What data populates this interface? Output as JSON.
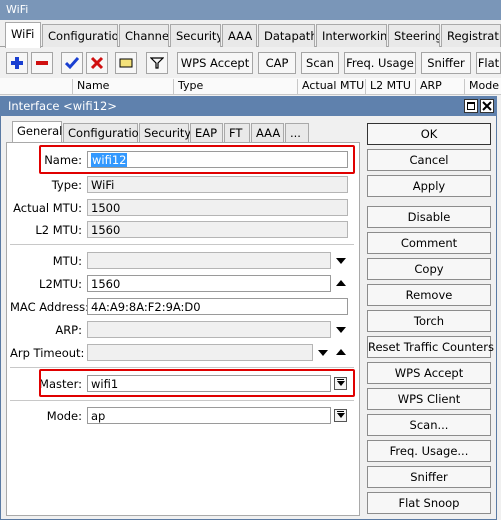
{
  "window": {
    "title": "WiFi"
  },
  "tabs": [
    {
      "label": "WiFi"
    },
    {
      "label": "Configuration"
    },
    {
      "label": "Channel"
    },
    {
      "label": "Security"
    },
    {
      "label": "AAA"
    },
    {
      "label": "Datapath"
    },
    {
      "label": "Interworking"
    },
    {
      "label": "Steering"
    },
    {
      "label": "Registration"
    }
  ],
  "toolbar": {
    "wps_accept": "WPS Accept",
    "cap": "CAP",
    "scan": "Scan",
    "freq_usage": "Freq. Usage",
    "sniffer": "Sniffer",
    "flat": "Flat"
  },
  "columns": [
    "Name",
    "Type",
    "Actual MTU",
    "L2 MTU",
    "ARP",
    "Mode"
  ],
  "dialog": {
    "title": "Interface <wifi12>",
    "tabs": [
      "General",
      "Configuration",
      "Security",
      "EAP",
      "FT",
      "AAA",
      "..."
    ],
    "fields": {
      "name_label": "Name:",
      "name_value": "wifi12",
      "type_label": "Type:",
      "type_value": "WiFi",
      "actual_mtu_label": "Actual MTU:",
      "actual_mtu_value": "1500",
      "l2_mtu_label": "L2 MTU:",
      "l2_mtu_value": "1560",
      "mtu_label": "MTU:",
      "mtu_value": "",
      "l2mtu_label": "L2MTU:",
      "l2mtu_value": "1560",
      "mac_label": "MAC Address:",
      "mac_value": "4A:A9:8A:F2:9A:D0",
      "arp_label": "ARP:",
      "arp_value": "",
      "arp_timeout_label": "Arp Timeout:",
      "arp_timeout_value": "",
      "master_label": "Master:",
      "master_value": "wifi1",
      "mode_label": "Mode:",
      "mode_value": "ap"
    },
    "buttons": [
      "OK",
      "Cancel",
      "Apply",
      "Disable",
      "Comment",
      "Copy",
      "Remove",
      "Torch",
      "Reset Traffic Counters",
      "WPS Accept",
      "WPS Client",
      "Scan...",
      "Freq. Usage...",
      "Sniffer",
      "Flat Snoop"
    ]
  },
  "colors": {
    "highlight": "#e00000",
    "title_bar": "#5f81ad",
    "selection": "#3399ff"
  }
}
